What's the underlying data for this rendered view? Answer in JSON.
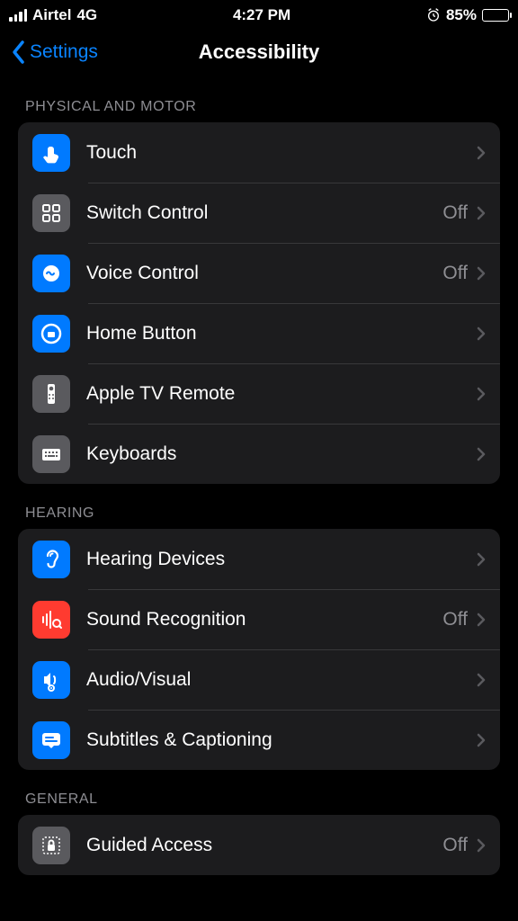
{
  "status": {
    "carrier": "Airtel",
    "network": "4G",
    "time": "4:27 PM",
    "battery": "85%"
  },
  "nav": {
    "back": "Settings",
    "title": "Accessibility"
  },
  "off": "Off",
  "sections": [
    {
      "header": "PHYSICAL AND MOTOR",
      "rows": [
        {
          "name": "touch",
          "label": "Touch",
          "value": "",
          "icon": "touch",
          "color": "bg-blue"
        },
        {
          "name": "switch-control",
          "label": "Switch Control",
          "value": "Off",
          "icon": "grid",
          "color": "bg-gray"
        },
        {
          "name": "voice-control",
          "label": "Voice Control",
          "value": "Off",
          "icon": "voice",
          "color": "bg-blue"
        },
        {
          "name": "home-button",
          "label": "Home Button",
          "value": "",
          "icon": "home",
          "color": "bg-blue"
        },
        {
          "name": "apple-tv-remote",
          "label": "Apple TV Remote",
          "value": "",
          "icon": "remote",
          "color": "bg-gray"
        },
        {
          "name": "keyboards",
          "label": "Keyboards",
          "value": "",
          "icon": "keyboard",
          "color": "bg-gray"
        }
      ]
    },
    {
      "header": "HEARING",
      "rows": [
        {
          "name": "hearing-devices",
          "label": "Hearing Devices",
          "value": "",
          "icon": "ear",
          "color": "bg-blue"
        },
        {
          "name": "sound-recognition",
          "label": "Sound Recognition",
          "value": "Off",
          "icon": "sound",
          "color": "bg-red"
        },
        {
          "name": "audio-visual",
          "label": "Audio/Visual",
          "value": "",
          "icon": "av",
          "color": "bg-blue"
        },
        {
          "name": "subtitles-captioning",
          "label": "Subtitles & Captioning",
          "value": "",
          "icon": "cc",
          "color": "bg-blue"
        }
      ]
    },
    {
      "header": "GENERAL",
      "rows": [
        {
          "name": "guided-access",
          "label": "Guided Access",
          "value": "Off",
          "icon": "lock",
          "color": "bg-gray"
        }
      ]
    }
  ]
}
